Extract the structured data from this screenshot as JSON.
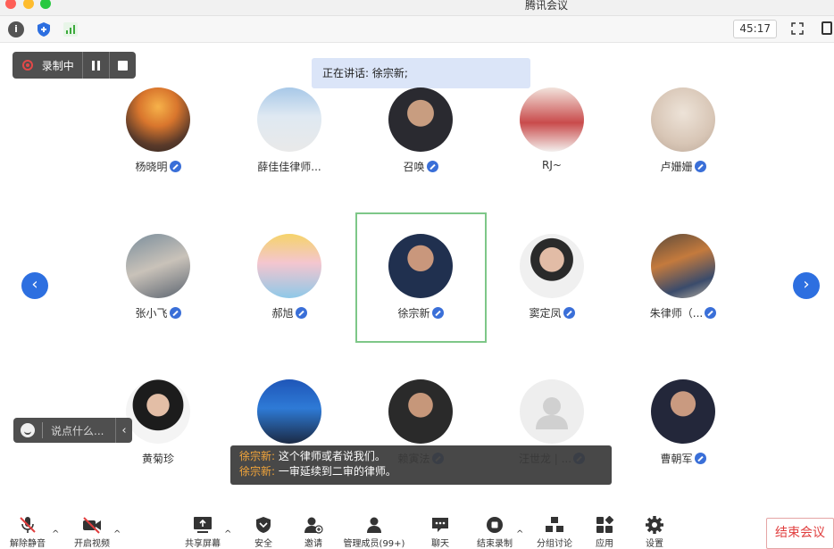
{
  "window": {
    "title": "腾讯会议"
  },
  "topbar": {
    "icons": [
      "info-icon",
      "shield-icon",
      "signal-icon"
    ],
    "timer": "45:17",
    "right_icons": [
      "fullscreen-icon",
      "window-icon"
    ]
  },
  "recording": {
    "label": "录制中"
  },
  "speaking": {
    "text": "正在讲话: 徐宗新;"
  },
  "participants": [
    {
      "name": "杨晓明",
      "mic": true
    },
    {
      "name": "薛佳佳律师...",
      "mic": false
    },
    {
      "name": "召唤",
      "mic": true
    },
    {
      "name": "RJ~",
      "mic": false
    },
    {
      "name": "卢姗姗",
      "mic": true
    },
    {
      "name": "张小飞",
      "mic": true
    },
    {
      "name": "郝旭",
      "mic": true
    },
    {
      "name": "徐宗新",
      "mic": true,
      "active": true
    },
    {
      "name": "窦定凤",
      "mic": true
    },
    {
      "name": "朱律师（...",
      "mic": true
    },
    {
      "name": "黄菊珍",
      "mic": false
    },
    {
      "name": "",
      "mic": false
    },
    {
      "name": "赖寅法",
      "mic": true
    },
    {
      "name": "汪世龙 | ...",
      "mic": true
    },
    {
      "name": "曹朝军",
      "mic": true
    }
  ],
  "chat": {
    "placeholder": "说点什么..."
  },
  "subtitle": {
    "lines": [
      {
        "speaker": "徐宗新:",
        "text": " 这个律师或者说我们。"
      },
      {
        "speaker": "徐宗新:",
        "text": " 一审延续到二审的律师。"
      }
    ]
  },
  "toolbar": {
    "unmute": "解除静音",
    "video": "开启视频",
    "share": "共享屏幕",
    "security": "安全",
    "invite": "邀请",
    "members": "管理成员(99+)",
    "chat": "聊天",
    "end_record": "结束录制",
    "breakout": "分组讨论",
    "apps": "应用",
    "settings": "设置",
    "end_meeting": "结束会议"
  },
  "colors": {
    "accent": "#2d6fe0",
    "active_border": "#7ec788",
    "end": "#e03e3e",
    "speaker_name": "#f2a53a"
  }
}
